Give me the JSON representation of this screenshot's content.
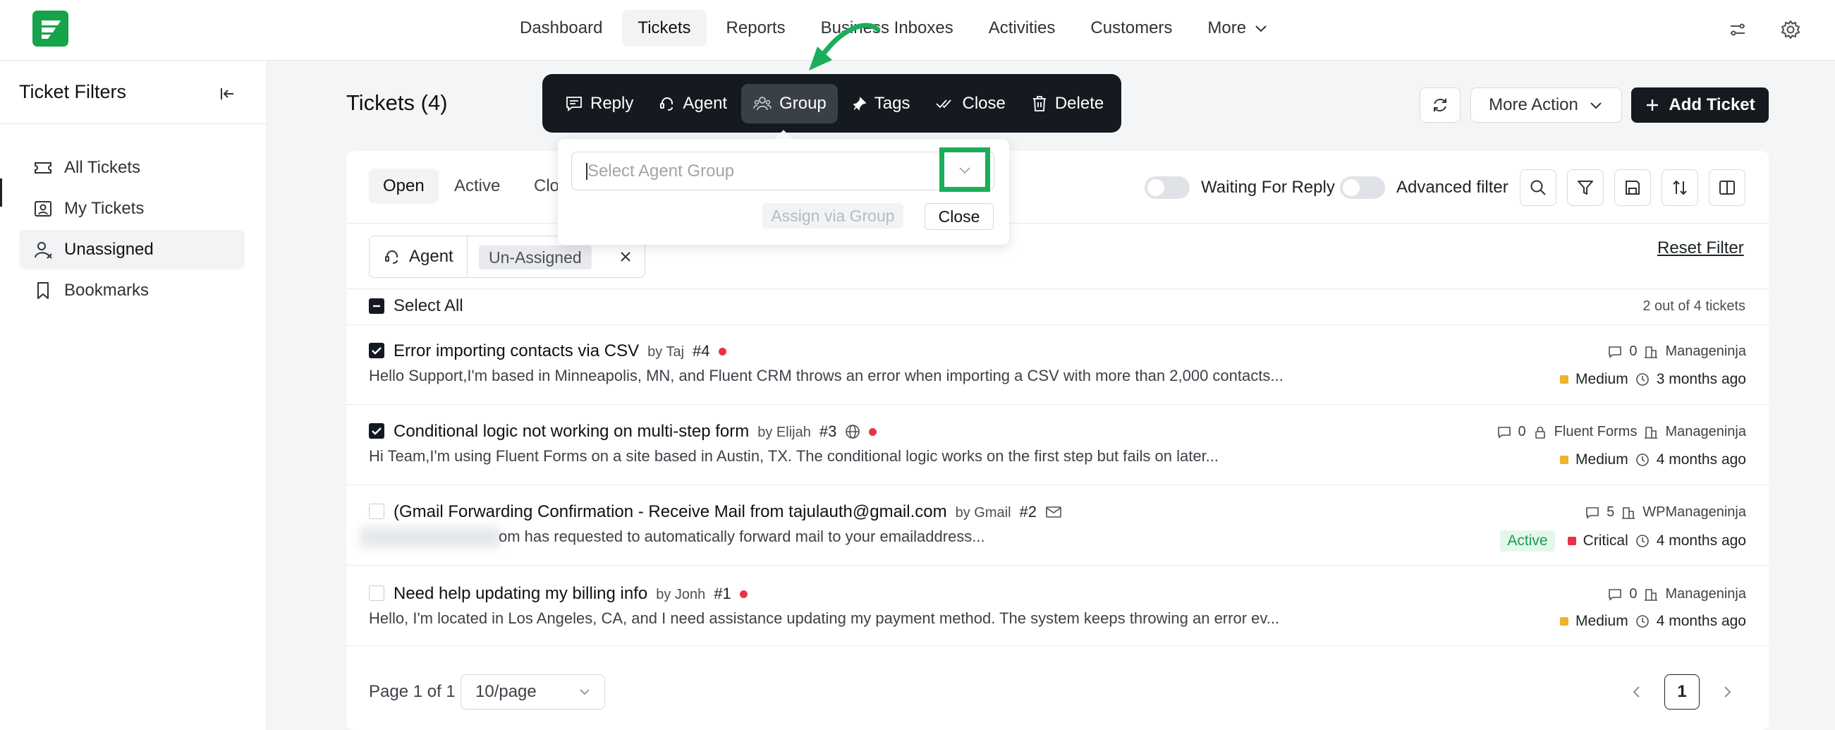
{
  "nav": {
    "items": [
      {
        "label": "Dashboard"
      },
      {
        "label": "Tickets"
      },
      {
        "label": "Reports"
      },
      {
        "label": "Business Inboxes"
      },
      {
        "label": "Activities"
      },
      {
        "label": "Customers"
      },
      {
        "label": "More"
      }
    ],
    "active": "Tickets"
  },
  "sidebar": {
    "title": "Ticket Filters",
    "items": [
      {
        "label": "All Tickets",
        "icon": "ticket-icon"
      },
      {
        "label": "My Tickets",
        "icon": "user-ticket-icon"
      },
      {
        "label": "Unassigned",
        "icon": "user-x-icon"
      },
      {
        "label": "Bookmarks",
        "icon": "bookmark-icon"
      }
    ],
    "active": "Unassigned"
  },
  "page": {
    "title": "Tickets (4)"
  },
  "bulk_toolbar": {
    "reply": "Reply",
    "agent": "Agent",
    "group": "Group",
    "tags": "Tags",
    "close": "Close",
    "delete": "Delete",
    "active": "Group"
  },
  "group_popup": {
    "placeholder": "Select Agent Group",
    "assign_label": "Assign via Group",
    "close_label": "Close"
  },
  "header_actions": {
    "more_action": "More Action",
    "add_ticket": "Add Ticket"
  },
  "tabs": [
    {
      "label": "Open"
    },
    {
      "label": "Active"
    },
    {
      "label": "Clo"
    }
  ],
  "tabs_active": "Open",
  "filters": {
    "waiting_for_reply": "Waiting For Reply",
    "advanced_filter": "Advanced filter",
    "chip_label": "Agent",
    "chip_value": "Un-Assigned",
    "reset": "Reset Filter"
  },
  "list": {
    "select_all": "Select All",
    "count": "2 out of 4 tickets"
  },
  "tickets": [
    {
      "title": "Error importing contacts via CSV",
      "by": "by Taj",
      "number": "#4",
      "excerpt": "Hello Support,I'm based in Minneapolis, MN, and Fluent CRM throws an error when importing a CSV with more than 2,000 contacts...",
      "replies": "0",
      "product": "",
      "mailbox": "Manageninja",
      "status": "",
      "priority": "Medium",
      "priority_color": "#f0b429",
      "time": "3 months ago",
      "checked": true
    },
    {
      "title": "Conditional logic not working on multi-step form",
      "by": "by Elijah",
      "number": "#3",
      "excerpt": "Hi Team,I'm using Fluent Forms on a site based in Austin, TX. The conditional logic works on the first step but fails on later...",
      "replies": "0",
      "product": "Fluent Forms",
      "mailbox": "Manageninja",
      "status": "",
      "priority": "Medium",
      "priority_color": "#f0b429",
      "time": "4 months ago",
      "checked": true
    },
    {
      "title": "(Gmail Forwarding Confirmation - Receive Mail from tajulauth@gmail.com",
      "by": "by Gmail",
      "number": "#2",
      "excerpt": "om has requested to automatically forward mail to your emailaddress...",
      "replies": "5",
      "product": "",
      "mailbox": "WPManageninja",
      "status": "Active",
      "priority": "Critical",
      "priority_color": "#e8334a",
      "time": "4 months ago",
      "checked": false
    },
    {
      "title": "Need help updating my billing info",
      "by": "by Jonh",
      "number": "#1",
      "excerpt": "Hello, I'm located in Los Angeles, CA, and I need assistance updating my payment method. The system keeps throwing an error ev...",
      "replies": "0",
      "product": "",
      "mailbox": "Manageninja",
      "status": "",
      "priority": "Medium",
      "priority_color": "#f0b429",
      "time": "4 months ago",
      "checked": false
    }
  ],
  "pagination": {
    "page_text": "Page 1 of 1",
    "per_page": "10/page",
    "current": "1"
  },
  "colors": {
    "brand": "#16a34a",
    "dark": "#141a1f",
    "highlight": "#1aae5a"
  }
}
